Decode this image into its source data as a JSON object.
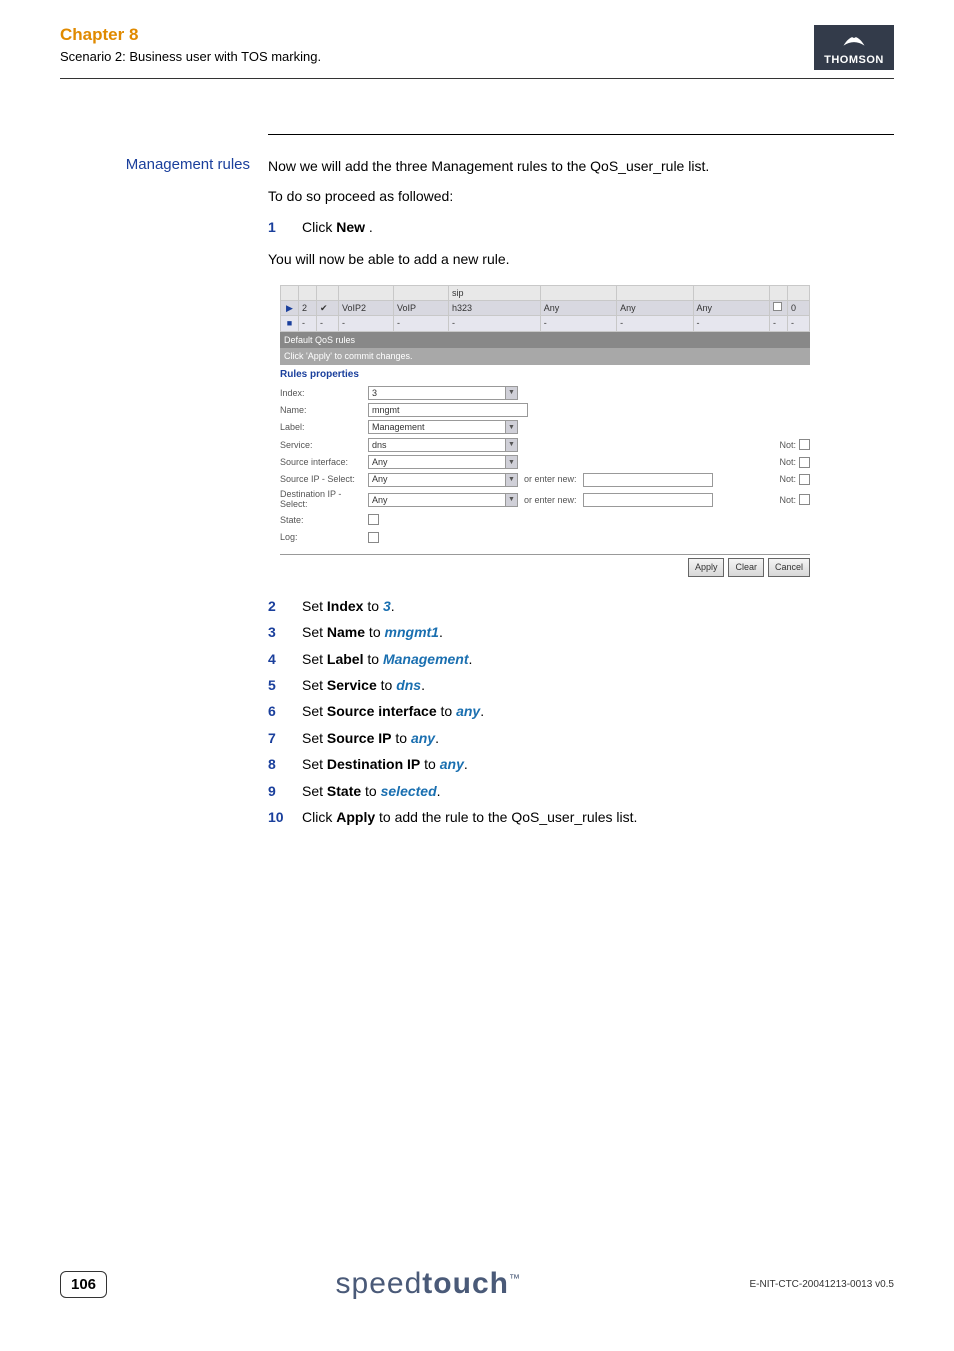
{
  "header": {
    "chapter": "Chapter 8",
    "scenario": "Scenario 2: Business user with TOS marking.",
    "logo_text": "THOMSON"
  },
  "side": {
    "heading": "Management rules"
  },
  "body": {
    "intro1": "Now we will add the three Management rules to the QoS_user_rule list.",
    "intro2": "To do so proceed as followed:",
    "step1_pre": "Click ",
    "step1_bold": "New",
    "step1_post": " .",
    "after1": "You will now be able to add a new rule.",
    "steps": [
      {
        "n": "2",
        "pre": "Set ",
        "b": "Index",
        "mid": " to ",
        "val": "3",
        "post": "."
      },
      {
        "n": "3",
        "pre": "Set ",
        "b": "Name",
        "mid": " to ",
        "val": "mngmt1",
        "post": "."
      },
      {
        "n": "4",
        "pre": "Set ",
        "b": "Label",
        "mid": " to ",
        "val": "Management",
        "post": "."
      },
      {
        "n": "5",
        "pre": "Set ",
        "b": "Service",
        "mid": " to ",
        "val": "dns",
        "post": "."
      },
      {
        "n": "6",
        "pre": "Set ",
        "b": "Source interface",
        "mid": " to ",
        "val": "any",
        "post": "."
      },
      {
        "n": "7",
        "pre": "Set ",
        "b": "Source IP",
        "mid": " to ",
        "val": "any",
        "post": "."
      },
      {
        "n": "8",
        "pre": "Set ",
        "b": "Destination IP",
        "mid": " to ",
        "val": "any",
        "post": "."
      },
      {
        "n": "9",
        "pre": "Set ",
        "b": "State",
        "mid": " to ",
        "val": "selected",
        "post": "."
      }
    ],
    "step10": {
      "n": "10",
      "pre": "Click ",
      "b": "Apply",
      "post": " to add the rule to the QoS_user_rules list."
    }
  },
  "ui": {
    "table": {
      "r0_c4": "sip",
      "r1_c1": "2",
      "r1_c3": "VoIP2",
      "r1_c4": "VoIP",
      "r1_c5": "h323",
      "r1_c6": "Any",
      "r1_c7": "Any",
      "r1_c8": "Any",
      "r1_c9": "0",
      "r2_dash": "-"
    },
    "bar1": "Default QoS rules",
    "bar2": "Click 'Apply' to commit changes.",
    "rules_prop": "Rules properties",
    "rows": {
      "index_label": "Index:",
      "index_val": "3",
      "name_label": "Name:",
      "name_val": "mngmt",
      "label_label": "Label:",
      "label_val": "Management",
      "service_label": "Service:",
      "service_val": "dns",
      "srcif_label": "Source interface:",
      "srcif_val": "Any",
      "srcip_label": "Source IP - Select:",
      "srcip_val": "Any",
      "dstip_label": "Destination IP - Select:",
      "dstip_val": "Any",
      "or_enter": "or enter new:",
      "not": "Not:",
      "state_label": "State:",
      "log_label": "Log:"
    },
    "buttons": {
      "apply": "Apply",
      "clear": "Clear",
      "cancel": "Cancel"
    }
  },
  "footer": {
    "page": "106",
    "brand_thin": "speed",
    "brand_thick": "touch",
    "doc": "E-NIT-CTC-20041213-0013 v0.5"
  }
}
